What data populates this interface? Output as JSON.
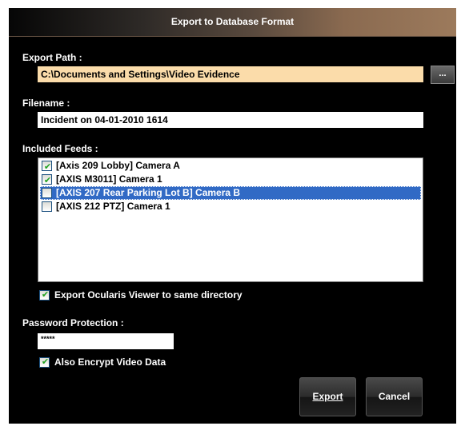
{
  "dialog": {
    "title": "Export to Database Format",
    "export_path": {
      "label": "Export Path :",
      "value": "C:\\Documents and Settings\\Video Evidence",
      "browse_label": "..."
    },
    "filename": {
      "label": "Filename :",
      "value": "Incident on 04-01-2010 1614"
    },
    "included_feeds": {
      "label": "Included Feeds :",
      "items": [
        {
          "label": "[Axis 209 Lobby] Camera A",
          "checked": true,
          "selected": false
        },
        {
          "label": "[AXIS M3011] Camera 1",
          "checked": true,
          "selected": false
        },
        {
          "label": "[AXIS 207 Rear Parking Lot B] Camera B",
          "checked": false,
          "selected": true
        },
        {
          "label": "[AXIS 212 PTZ] Camera 1",
          "checked": false,
          "selected": false
        }
      ]
    },
    "export_viewer": {
      "label": "Export Ocularis Viewer to same directory",
      "checked": true
    },
    "password": {
      "label": "Password Protection :",
      "value": "*****"
    },
    "encrypt": {
      "label": "Also Encrypt Video Data",
      "checked": true
    },
    "buttons": {
      "export": "Export",
      "cancel": "Cancel"
    }
  }
}
